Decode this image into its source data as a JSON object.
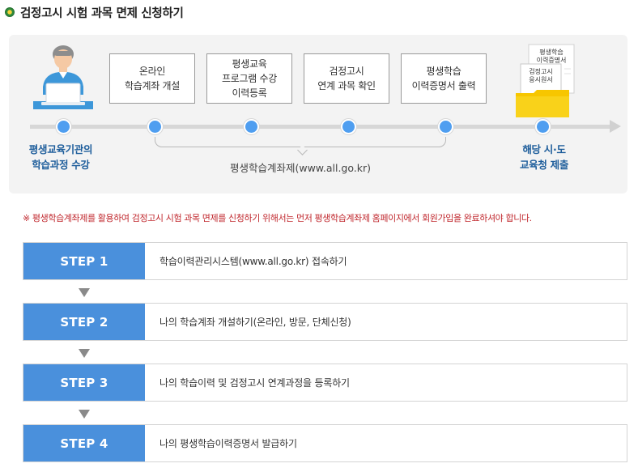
{
  "header": {
    "title": "검정고시 시험 과목 면제 신청하기"
  },
  "process": {
    "start_label_line1": "평생교육기관의",
    "start_label_line2": "학습과정 수강",
    "end_label_line1": "해당 시·도",
    "end_label_line2": "교육청 제출",
    "boxes": [
      {
        "line1": "온라인",
        "line2": "학습계좌 개설"
      },
      {
        "line1": "평생교육",
        "line2": "프로그램 수강",
        "line3": "이력등록"
      },
      {
        "line1": "검정고시",
        "line2": "연계 과목 확인"
      },
      {
        "line1": "평생학습",
        "line2": "이력증명서 출력"
      }
    ],
    "bracket_label": "평생학습계좌제(www.all.go.kr)",
    "docs": {
      "doc_back_line1": "평생학습",
      "doc_back_line2": "이력증명서",
      "doc_front_line1": "검정고시",
      "doc_front_line2": "응시원서"
    }
  },
  "notice": "※ 평생학습계좌제를 활용하여 검정고시 시험 과목 면제를 신청하기 위해서는 먼저 평생학습계좌제 홈페이지에서 회원가입을 완료하셔야 합니다.",
  "steps": [
    {
      "label": "STEP 1",
      "text": "학습이력관리시스템(www.all.go.kr) 접속하기"
    },
    {
      "label": "STEP 2",
      "text": "나의 학습계좌 개설하기(온라인, 방문, 단체신청)"
    },
    {
      "label": "STEP 3",
      "text": "나의 학습이력 및 검정고시 연계과정을 등록하기"
    },
    {
      "label": "STEP 4",
      "text": "나의 평생학습이력증명서 발급하기"
    }
  ],
  "colors": {
    "step_blue": "#4a90dc",
    "dot_blue": "#4f9ef0",
    "label_blue": "#1d5d9b",
    "notice_red": "#c0272d",
    "folder_yellow": "#f7c600"
  }
}
